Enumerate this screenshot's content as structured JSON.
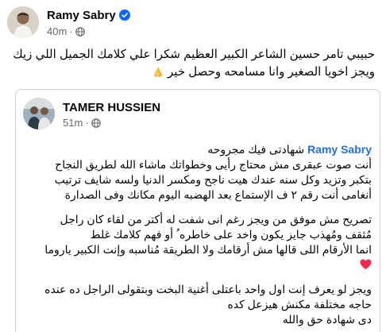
{
  "post": {
    "author": "Ramy Sabry",
    "time": "40m",
    "separator": "·",
    "lines": [
      "حبيبي تامر حسين الشاعر الكبير العظيم شكرا علي كلامك الجميل اللي زيك",
      "ويجز اخويا الصغير وانا مسامحه وحصل خير"
    ],
    "emoji": "folded-hands-emoji"
  },
  "shared_post": {
    "author": "TAMER HUSSIEN",
    "time": "51m",
    "separator": "·",
    "intro_suffix": "شهادتى فيك مجروحه",
    "mention": "Ramy Sabry",
    "paragraph_1": [
      "أنت صوت عبقرى مش محتاج رأيى وخطواتك ماشاء الله لطريق النجاح",
      "بتكبر وتزيد  وكل سنه عندك هيت ناجح ومكسر الدنيا ولسه شايف ترتيب",
      "أنغامى أنت رقم ٢ ف الإستماع بعد الهضبه اليوم مكانك وفى الصدارة"
    ],
    "paragraph_2": [
      "تصريح مش موفق من ويجز رغم انى شفت له أكتر من لقاء كان راجل",
      "مُثقف ومُهذب جايز يكون واخد على خاطره ُ أو فهم كلامك غلط",
      "انما الأرقام اللى قالها مش أرقامك ولا الطريقة مُناسبه وإنت الكبير ياروما"
    ],
    "heart": "red-heart-emoji",
    "paragraph_3": [
      "ويجز لو يعرف إنت اول واحد باعتلى أغنية البخت وبتقولى الراجل ده عنده",
      "حاجه مختلفة  مكنش هيزعل كده",
      "دى شهادة حق والله"
    ]
  },
  "colors": {
    "verified": "#0866ff",
    "mention": "#216fdb",
    "meta": "#65676b",
    "border": "#ced0d4",
    "heart": "#f02849"
  }
}
